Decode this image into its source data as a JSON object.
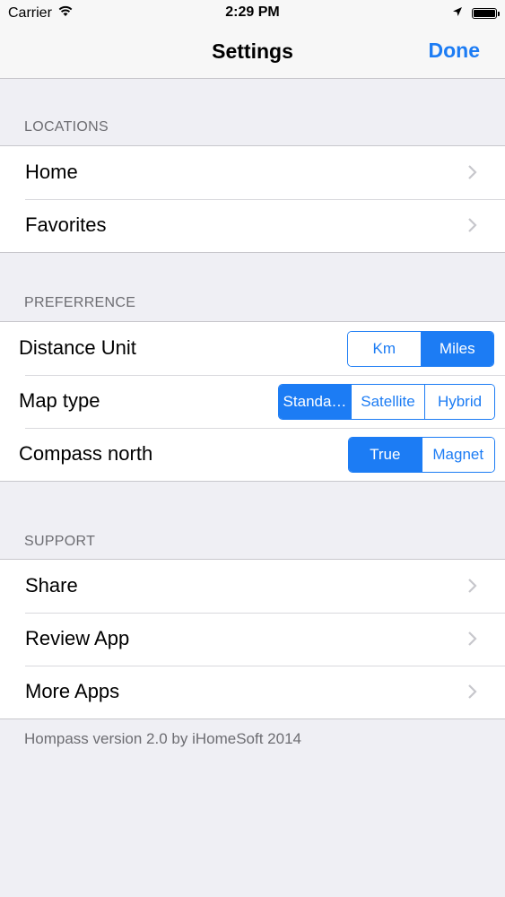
{
  "status_bar": {
    "carrier": "Carrier",
    "time": "2:29 PM",
    "icons": [
      "wifi-icon",
      "location-arrow-icon",
      "battery-icon"
    ],
    "battery_level": 1.0
  },
  "nav": {
    "title": "Settings",
    "done_label": "Done",
    "accent_color": "#1c7cf4"
  },
  "locations": {
    "header": "LOCATIONS",
    "items": [
      {
        "label": "Home"
      },
      {
        "label": "Favorites"
      }
    ]
  },
  "preference": {
    "header": "PREFERRENCE",
    "distance_unit": {
      "label": "Distance Unit",
      "options": [
        "Km",
        "Miles"
      ],
      "selected": "Miles"
    },
    "map_type": {
      "label": "Map type",
      "options": [
        "Standa…",
        "Satellite",
        "Hybrid"
      ],
      "selected": "Standa…"
    },
    "compass_north": {
      "label": "Compass north",
      "options": [
        "True",
        "Magnet"
      ],
      "selected": "True"
    }
  },
  "support": {
    "header": "SUPPORT",
    "items": [
      {
        "label": "Share"
      },
      {
        "label": "Review App"
      },
      {
        "label": "More Apps"
      }
    ]
  },
  "footer": {
    "text": "Hompass version 2.0 by iHomeSoft 2014"
  }
}
